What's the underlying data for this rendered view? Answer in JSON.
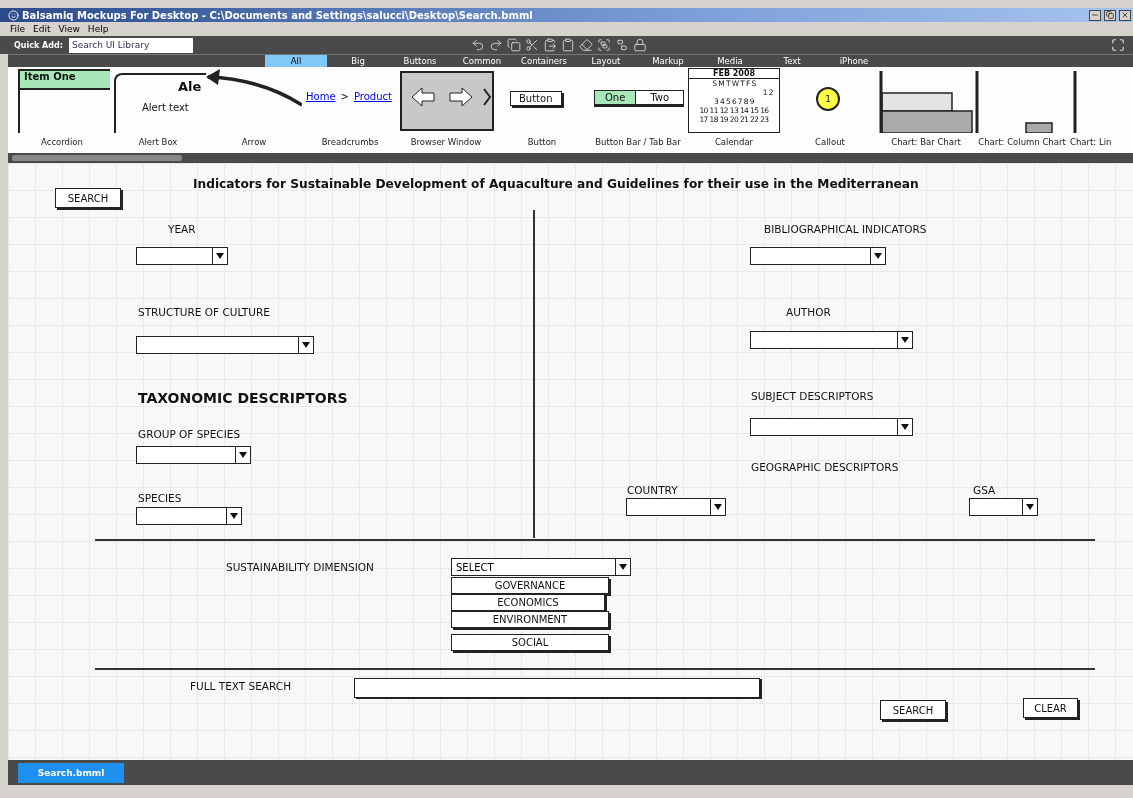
{
  "window": {
    "title": "Balsamiq Mockups For Desktop - C:\\Documents and Settings\\salucci\\Desktop\\Search.bmml"
  },
  "menu": [
    "File",
    "Edit",
    "View",
    "Help"
  ],
  "quick_add": {
    "label": "Quick Add:",
    "placeholder": "Search UI Library"
  },
  "categories": [
    {
      "label": "All",
      "selected": true
    },
    {
      "label": "Big",
      "selected": false
    },
    {
      "label": "Buttons",
      "selected": false
    },
    {
      "label": "Common",
      "selected": false
    },
    {
      "label": "Containers",
      "selected": false
    },
    {
      "label": "Layout",
      "selected": false
    },
    {
      "label": "Markup",
      "selected": false
    },
    {
      "label": "Media",
      "selected": false
    },
    {
      "label": "Text",
      "selected": false
    },
    {
      "label": "iPhone",
      "selected": false
    }
  ],
  "library": [
    {
      "kind": "accordion",
      "label": "Accordion",
      "texts": [
        "Item One"
      ]
    },
    {
      "kind": "alert",
      "label": "Alert Box",
      "texts": [
        "Ale",
        "Alert text"
      ]
    },
    {
      "kind": "arrow",
      "label": "Arrow"
    },
    {
      "kind": "breadcrumbs",
      "label": "Breadcrumbs",
      "texts": [
        "Home",
        ">",
        "Product"
      ]
    },
    {
      "kind": "browser",
      "label": "Browser Window"
    },
    {
      "kind": "button",
      "label": "Button",
      "texts": [
        "Button"
      ]
    },
    {
      "kind": "buttonbar",
      "label": "Button Bar / Tab Bar",
      "texts": [
        "One",
        "Two"
      ]
    },
    {
      "kind": "calendar",
      "label": "Calendar",
      "texts": [
        "FEB 2008",
        "S M T W T F S",
        "1 2",
        "3 4 5 6 7 8 9",
        "10 11 12 13 14 15 16",
        "17 18 19 20 21 22 23"
      ]
    },
    {
      "kind": "callout",
      "label": "Callout",
      "texts": [
        "1"
      ]
    },
    {
      "kind": "barchart",
      "label": "Chart: Bar Chart"
    },
    {
      "kind": "columnchart",
      "label": "Chart: Column Chart"
    },
    {
      "kind": "linechart",
      "label": "Chart: Lin"
    }
  ],
  "mockup": [
    {
      "kind": "button",
      "text": "SEARCH"
    },
    {
      "kind": "title",
      "text": "Indicators for Sustainable Development of Aquaculture and Guidelines for their use in the Mediterranean"
    },
    {
      "kind": "label",
      "text": "YEAR"
    },
    {
      "kind": "dropdown"
    },
    {
      "kind": "label",
      "text": "STRUCTURE OF CULTURE"
    },
    {
      "kind": "dropdown"
    },
    {
      "kind": "heading",
      "text": "TAXONOMIC DESCRIPTORS"
    },
    {
      "kind": "label",
      "text": "GROUP OF SPECIES"
    },
    {
      "kind": "dropdown"
    },
    {
      "kind": "label",
      "text": "SPECIES"
    },
    {
      "kind": "dropdown"
    },
    {
      "kind": "label",
      "text": "BIBLIOGRAPHICAL INDICATORS"
    },
    {
      "kind": "dropdown"
    },
    {
      "kind": "label",
      "text": "AUTHOR"
    },
    {
      "kind": "dropdown"
    },
    {
      "kind": "label",
      "text": "SUBJECT DESCRIPTORS"
    },
    {
      "kind": "dropdown"
    },
    {
      "kind": "label",
      "text": "GEOGRAPHIC DESCRIPTORS"
    },
    {
      "kind": "label",
      "text": "COUNTRY"
    },
    {
      "kind": "dropdown"
    },
    {
      "kind": "label",
      "text": "GSA"
    },
    {
      "kind": "dropdown"
    },
    {
      "kind": "label",
      "text": "SUSTAINABILITY DIMENSION"
    },
    {
      "kind": "dropdown",
      "value": "SELECT"
    },
    {
      "kind": "option",
      "text": "GOVERNANCE"
    },
    {
      "kind": "option",
      "text": "ECONOMICS"
    },
    {
      "kind": "option",
      "text": "ENVIRONMENT"
    },
    {
      "kind": "option",
      "text": "SOCIAL"
    },
    {
      "kind": "label",
      "text": "FULL TEXT SEARCH"
    },
    {
      "kind": "text_field"
    },
    {
      "kind": "button",
      "text": "SEARCH"
    },
    {
      "kind": "button",
      "text": "CLEAR"
    }
  ],
  "documents": [
    {
      "label": "Search.bmml",
      "selected": true
    }
  ]
}
